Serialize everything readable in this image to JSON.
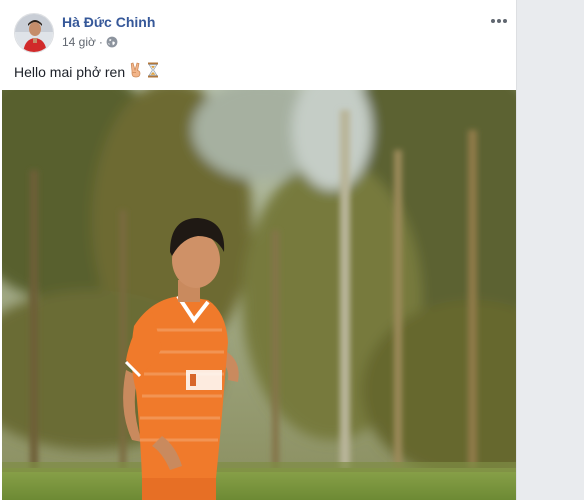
{
  "post": {
    "author": "Hà Đức Chinh",
    "time": "14 giờ",
    "privacy_icon": "globe-icon",
    "more_icon": "more-options-icon",
    "text": "Hello mai phở ren",
    "emojis": [
      "victory-hand-icon",
      "hourglass-icon"
    ]
  },
  "colors": {
    "author_link": "#365899",
    "meta_text": "#616770",
    "body_text": "#1d2129",
    "page_background": "#e9ebee",
    "card_background": "#ffffff",
    "jersey_orange": "#f07a2b"
  }
}
